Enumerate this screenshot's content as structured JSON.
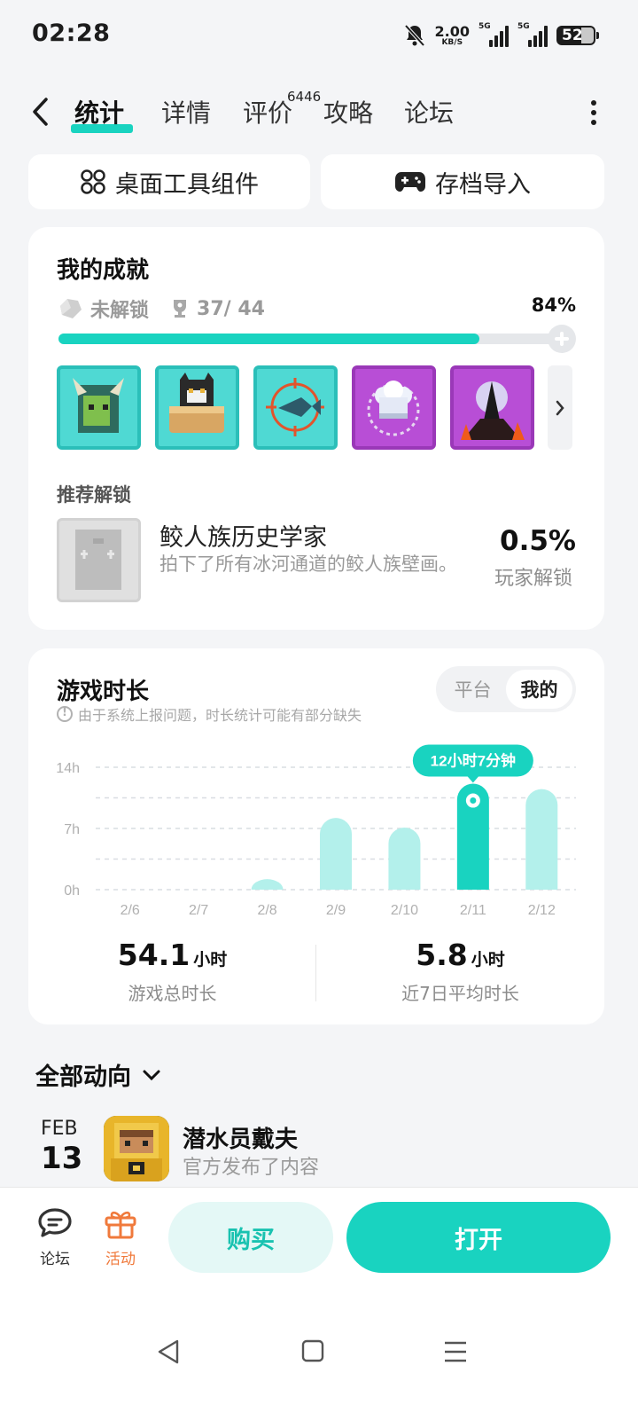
{
  "status_bar": {
    "time": "02:28",
    "net_speed_value": "2.00",
    "net_speed_unit": "KB/S",
    "sim1_label": "5G",
    "sim2_label": "5G",
    "battery_level": "52"
  },
  "nav": {
    "tabs": [
      "统计",
      "详情",
      "评价",
      "攻略",
      "论坛"
    ],
    "active_tab": "统计",
    "review_count": "6446"
  },
  "quick_actions": {
    "widget_label": "桌面工具组件",
    "save_import_label": "存档导入"
  },
  "achievements": {
    "title": "我的成就",
    "locked_label": "未解锁",
    "progress_text": "37/ 44",
    "percent_text": "84%",
    "progress_fraction": 0.84,
    "badges": [
      {
        "icon": "horned-warrior-badge",
        "frame": "teal"
      },
      {
        "icon": "cat-pie-badge",
        "frame": "teal"
      },
      {
        "icon": "fish-target-badge",
        "frame": "teal"
      },
      {
        "icon": "chef-hat-badge",
        "frame": "purple"
      },
      {
        "icon": "dark-shrine-badge",
        "frame": "purple"
      }
    ],
    "recommended": {
      "section_title": "推荐解锁",
      "name": "鲛人族历史学家",
      "description": "拍下了所有冰河通道的鲛人族壁画。",
      "percent": "0.5%",
      "percent_label": "玩家解锁"
    }
  },
  "playtime": {
    "title": "游戏时长",
    "note": "由于系统上报问题，时长统计可能有部分缺失",
    "toggle": {
      "options": [
        "平台",
        "我的"
      ],
      "selected": "我的"
    },
    "tooltip": "12小时7分钟",
    "totals": [
      {
        "value": "54.1",
        "unit": "小时",
        "label": "游戏总时长"
      },
      {
        "value": "5.8",
        "unit": "小时",
        "label": "近7日平均时长"
      }
    ]
  },
  "chart_data": {
    "type": "bar",
    "categories": [
      "2/6",
      "2/7",
      "2/8",
      "2/9",
      "2/10",
      "2/11",
      "2/12"
    ],
    "values": [
      0,
      0,
      1.2,
      8.2,
      7.1,
      12.12,
      11.5
    ],
    "value_unit": "hours",
    "y_ticks": [
      "0h",
      "7h",
      "14h"
    ],
    "ylim": [
      0,
      14
    ],
    "highlighted_index": 5,
    "colors": {
      "bar": "#b3f0eb",
      "highlight": "#19d3c0"
    }
  },
  "activity": {
    "title": "全部动向",
    "items": [
      {
        "month": "FEB",
        "day": "13",
        "name": "潜水员戴夫",
        "description": "官方发布了内容"
      }
    ]
  },
  "bottom_bar": {
    "forum_label": "论坛",
    "event_label": "活动",
    "buy_label": "购买",
    "open_label": "打开"
  },
  "colors": {
    "accent": "#19d3c0",
    "accent_light": "#e4f8f6",
    "event_orange": "#f07a3c"
  }
}
